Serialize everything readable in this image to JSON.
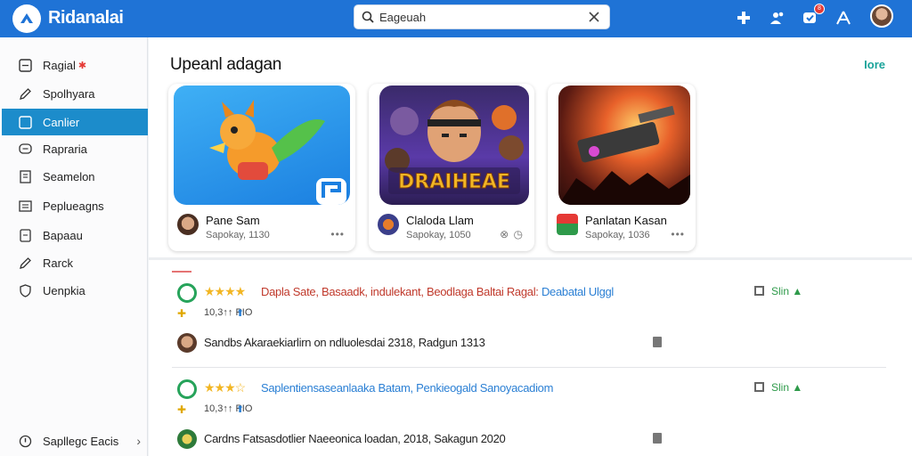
{
  "app": {
    "title": "Ridanalai",
    "brand_color": "#1f73d6",
    "accent_color": "#1c8ccb"
  },
  "search": {
    "value": "Eageuah",
    "search_icon": "search-icon",
    "clear_icon": "close-icon"
  },
  "topbar": {
    "icons": [
      "puzzle-icon",
      "people-icon",
      "notifications-icon",
      "share-icon"
    ],
    "notification_count": "8"
  },
  "sidebar": {
    "items": [
      {
        "label": "Ragial",
        "icon": "window-icon",
        "flag": "✱",
        "active": false
      },
      {
        "label": "Spolhyara",
        "icon": "pencil-icon",
        "flag": "",
        "active": false
      },
      {
        "label": "Canlier",
        "icon": "window-icon",
        "flag": "",
        "active": true
      },
      {
        "label": "Rapraria",
        "icon": "chat-icon",
        "flag": "",
        "active": false
      },
      {
        "label": "Seamelon",
        "icon": "document-icon",
        "flag": "",
        "active": false
      },
      {
        "label": "Peplueagns",
        "icon": "list-icon",
        "flag": "",
        "active": false
      },
      {
        "label": "Bapaau",
        "icon": "bookmark-icon",
        "flag": "",
        "active": false
      },
      {
        "label": "Rarck",
        "icon": "pencil-icon",
        "flag": "",
        "active": false
      },
      {
        "label": "Uenpkia",
        "icon": "shield-icon",
        "flag": "",
        "active": false
      }
    ],
    "footer": {
      "label": "Sapllegc Eacis",
      "icon": "info-icon"
    }
  },
  "section": {
    "title": "Upeanl adagan",
    "more_label": "Iore"
  },
  "cards": [
    {
      "name": "Pane Sam",
      "meta": "Sapokay, 1130",
      "art_label": "",
      "menu": "•••"
    },
    {
      "name": "Claloda Llam",
      "meta": "Sapokay, 1050",
      "art_label": "DRAIHEAE",
      "menu": "⊗ ◷"
    },
    {
      "name": "Panlatan Kasan",
      "meta": "Sapokay, 1036",
      "art_label": "",
      "menu": "•••"
    }
  ],
  "rows": [
    {
      "stars": "★★★★",
      "title_prefix": "Dapla Sate, Basaadk, indulekant, Beodlaga Baltai Ragal:",
      "title_suffix": "Deabatal Ulggl",
      "title_color": "#c0392b",
      "badge": "✚",
      "meta": "10,3↑↑ PIO",
      "status": "Slin",
      "user_text": "Sandbs Akaraekiarlirn on ndluolesdai 2318, Radgun 1313"
    },
    {
      "stars": "★★★☆",
      "title_prefix": "Saplentiensaseanlaaka Batam, Penkieogald Sanoyacadiom",
      "title_suffix": "",
      "title_color": "#2a7fd4",
      "badge": "✚",
      "meta": "10,3↑↑ PIO",
      "status": "Slin",
      "user_text": "Cardns Fatsasdotlier Naeeonica loadan, 2018, Sakagun 2020"
    }
  ]
}
